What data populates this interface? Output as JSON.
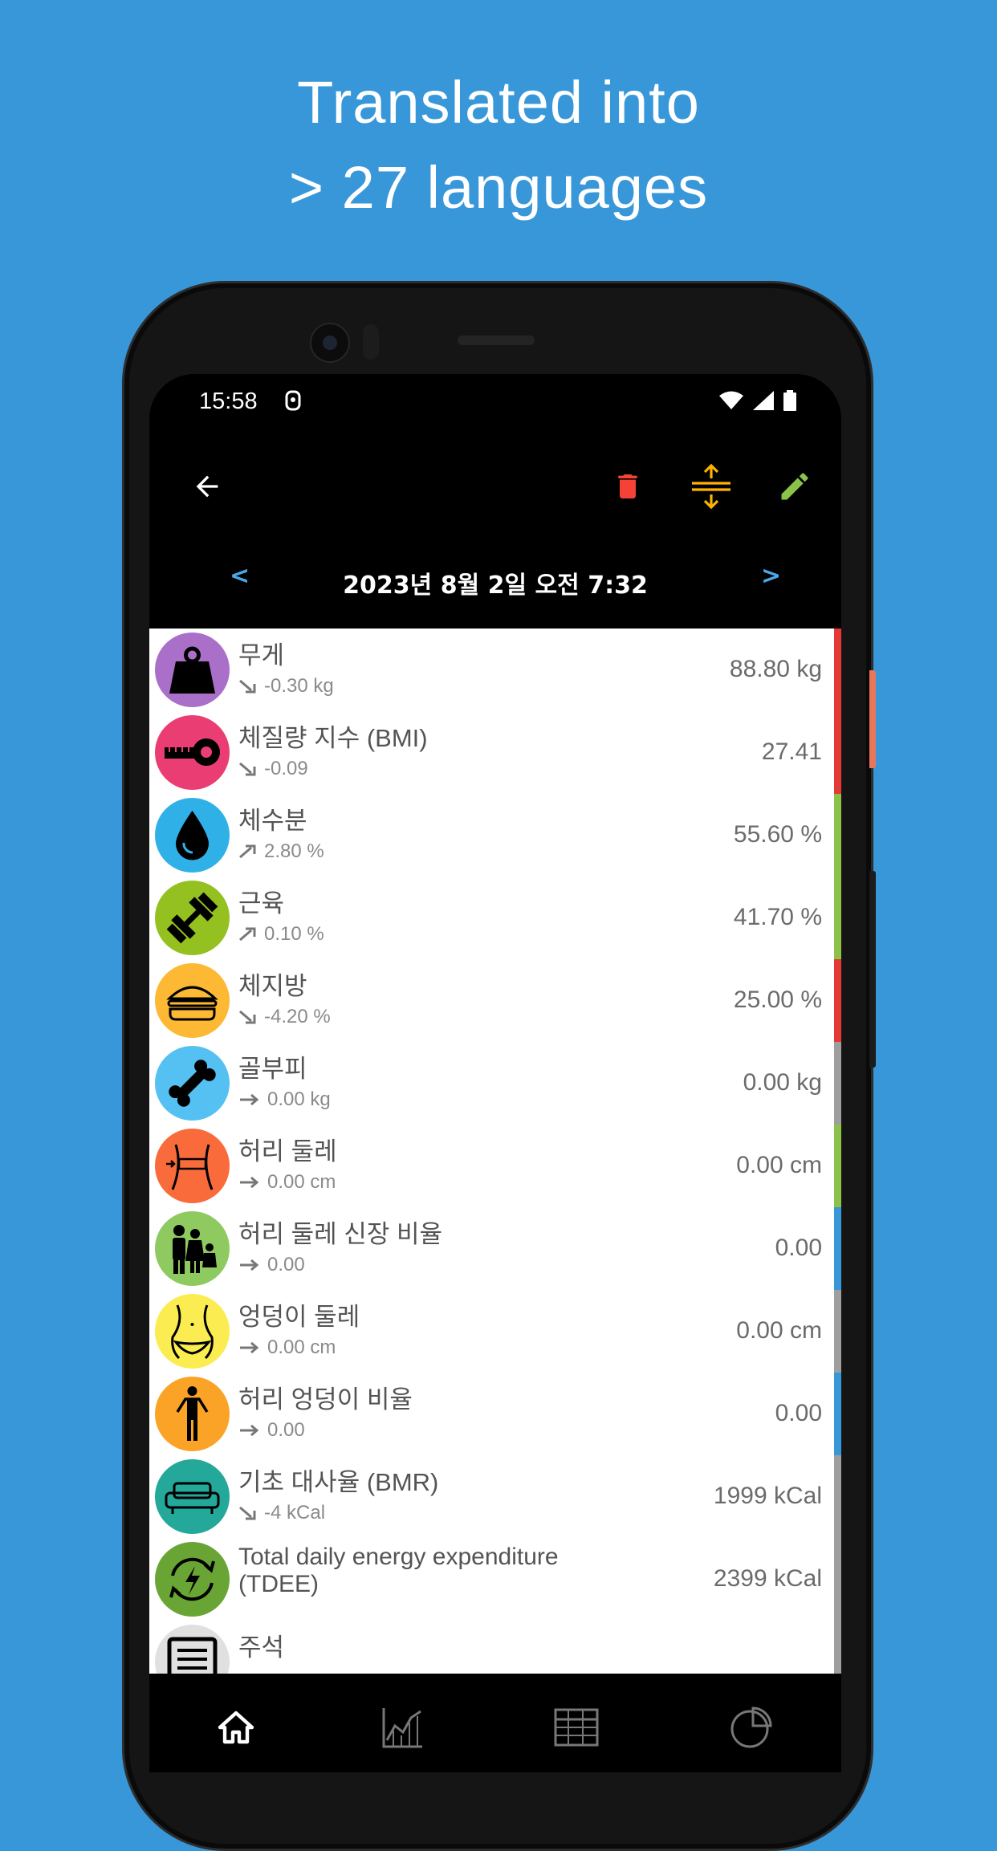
{
  "headline": {
    "line1": "Translated into",
    "line2": "> 27 languages"
  },
  "status_bar": {
    "time": "15:58",
    "icons": [
      "screen-record-icon",
      "wifi-icon",
      "signal-icon",
      "battery-icon"
    ]
  },
  "toolbar": {
    "back_icon": "arrow-left-icon",
    "actions": [
      {
        "name": "delete",
        "icon": "trash-icon",
        "color": "#f44336"
      },
      {
        "name": "compare",
        "icon": "expand-vertical-icon",
        "color": "#ffb300"
      },
      {
        "name": "edit",
        "icon": "pencil-icon",
        "color": "#8bc34a"
      }
    ]
  },
  "date_nav": {
    "prev": "<",
    "date": "2023년 8월 2일 오전 7:32",
    "next": ">"
  },
  "measurements": [
    {
      "label": "무게",
      "delta": "-0.30 kg",
      "trend": "down",
      "value": "88.80 kg",
      "icon": "weight-icon",
      "icon_bg": "#a96fc9",
      "bar": "#e53935"
    },
    {
      "label": "체질량 지수 (BMI)",
      "delta": "-0.09",
      "trend": "down",
      "value": "27.41",
      "icon": "tape-measure-icon",
      "icon_bg": "#ea3d74",
      "bar": "#e53935"
    },
    {
      "label": "체수분",
      "delta": "2.80 %",
      "trend": "up",
      "value": "55.60 %",
      "icon": "water-drop-icon",
      "icon_bg": "#2fb1e8",
      "bar": "#8bc34a"
    },
    {
      "label": "근육",
      "delta": "0.10 %",
      "trend": "up",
      "value": "41.70 %",
      "icon": "dumbbell-icon",
      "icon_bg": "#94c11f",
      "bar": "#8bc34a"
    },
    {
      "label": "체지방",
      "delta": "-4.20 %",
      "trend": "down",
      "value": "25.00 %",
      "icon": "burger-icon",
      "icon_bg": "#fdb834",
      "bar": "#e53935"
    },
    {
      "label": "골부피",
      "delta": "0.00 kg",
      "trend": "flat",
      "value": "0.00 kg",
      "icon": "bone-icon",
      "icon_bg": "#54c1f2",
      "bar": "#9e9e9e"
    },
    {
      "label": "허리 둘레",
      "delta": "0.00 cm",
      "trend": "flat",
      "value": "0.00 cm",
      "icon": "waist-icon",
      "icon_bg": "#f96b3b",
      "bar": "#8bc34a"
    },
    {
      "label": "허리 둘레 신장 비율",
      "delta": "0.00",
      "trend": "flat",
      "value": "0.00",
      "icon": "family-icon",
      "icon_bg": "#8fca61",
      "bar": "#3897d9"
    },
    {
      "label": "엉덩이 둘레",
      "delta": "0.00 cm",
      "trend": "flat",
      "value": "0.00 cm",
      "icon": "hips-icon",
      "icon_bg": "#fbed51",
      "bar": "#9e9e9e"
    },
    {
      "label": "허리 엉덩이 비율",
      "delta": "0.00",
      "trend": "flat",
      "value": "0.00",
      "icon": "person-icon",
      "icon_bg": "#fba326",
      "bar": "#3897d9"
    },
    {
      "label": "기초 대사율 (BMR)",
      "delta": "-4 kCal",
      "trend": "down",
      "value": "1999 kCal",
      "icon": "sofa-icon",
      "icon_bg": "#23a89a",
      "bar": "#9e9e9e"
    },
    {
      "label": "Total daily energy expenditure (TDEE)",
      "delta": "",
      "trend": "none",
      "value": "2399 kCal",
      "icon": "energy-cycle-icon",
      "icon_bg": "#69a534",
      "bar": "#9e9e9e"
    },
    {
      "label": "주석",
      "delta": "",
      "trend": "none",
      "value": "",
      "icon": "note-icon",
      "icon_bg": "#e0e0e0",
      "bar": "#9e9e9e"
    }
  ],
  "bottom_nav": [
    {
      "name": "home",
      "icon": "home-icon",
      "active": true
    },
    {
      "name": "graph",
      "icon": "chart-icon",
      "active": false
    },
    {
      "name": "table",
      "icon": "table-icon",
      "active": false
    },
    {
      "name": "statistics",
      "icon": "pie-chart-icon",
      "active": false
    }
  ]
}
